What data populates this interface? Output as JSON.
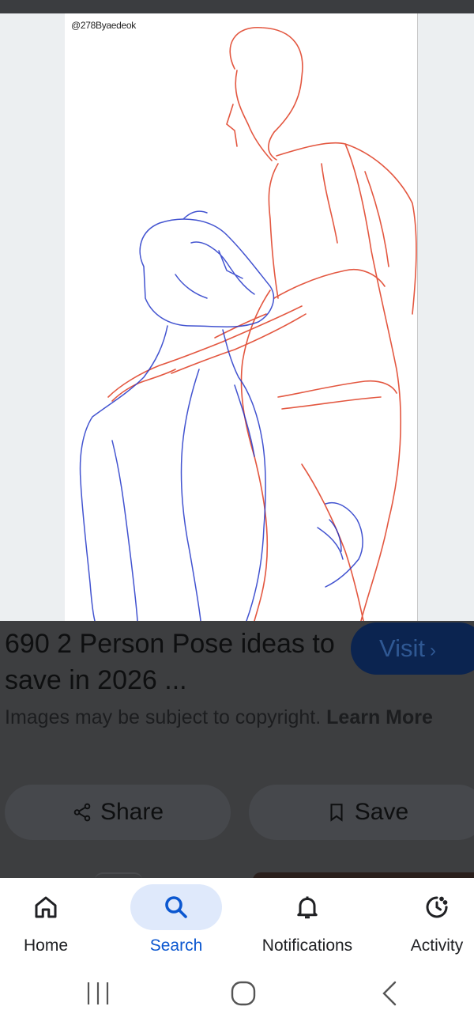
{
  "image": {
    "watermark": "@278Byaedeok"
  },
  "result": {
    "title": "690 2 Person Pose ideas to save in 2026 ...",
    "visit_label": "Visit",
    "visit_chevron": "›",
    "notice_text": "Images may be subject to copyright.",
    "notice_link": "Learn More"
  },
  "actions": {
    "share_label": "Share",
    "save_label": "Save"
  },
  "bottom_nav": {
    "items": [
      {
        "label": "Home",
        "icon": "home-icon",
        "active": false
      },
      {
        "label": "Search",
        "icon": "search-icon",
        "active": true
      },
      {
        "label": "Notifications",
        "icon": "bell-icon",
        "active": false
      },
      {
        "label": "Activity",
        "icon": "activity-icon",
        "active": false
      }
    ]
  },
  "system_nav": {
    "icons": [
      "recent-apps-icon",
      "home-circle-icon",
      "back-icon"
    ]
  },
  "colors": {
    "panel_bg": "#3d3e40",
    "visit_bg": "#0b2450",
    "active_blue": "#0b57d0",
    "active_pill": "#dfe9fb",
    "sketch_red": "#e0452c",
    "sketch_blue": "#2236c8"
  }
}
